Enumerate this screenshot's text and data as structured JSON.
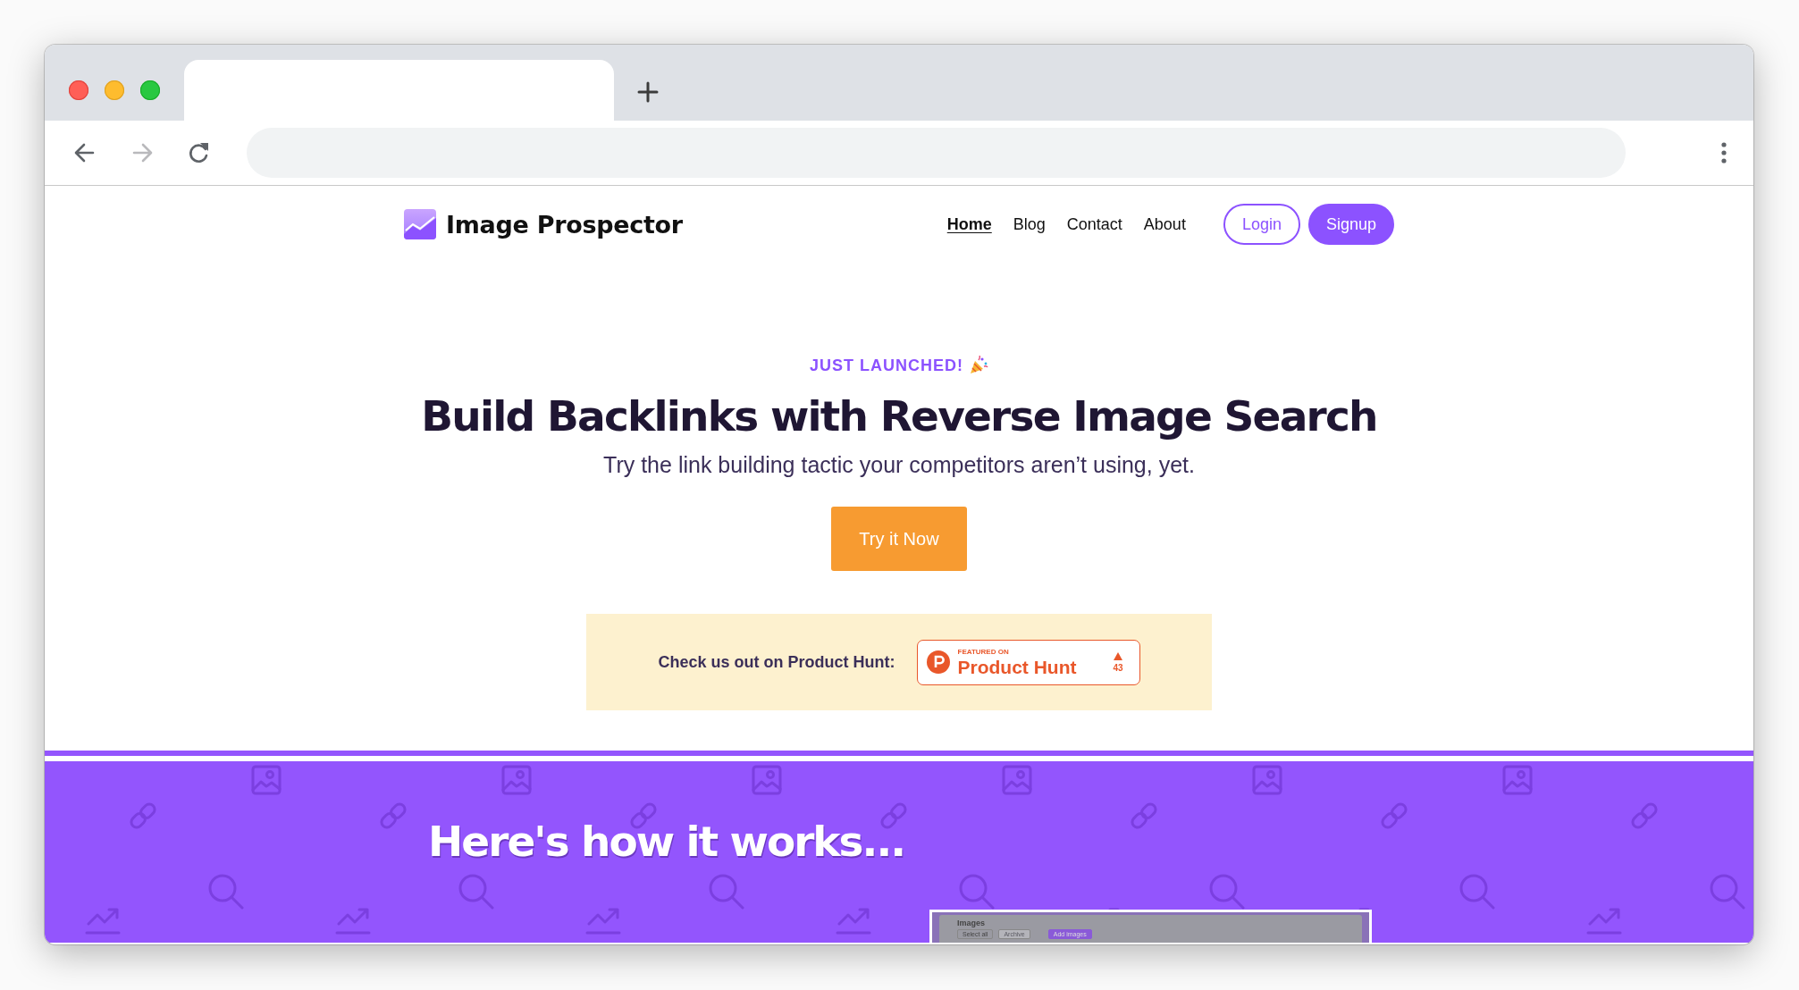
{
  "browser": {
    "back": {
      "disabled": false
    },
    "forward": {
      "disabled": true
    }
  },
  "nav": {
    "logo": "Image Prospector",
    "links": [
      {
        "label": "Home",
        "selected": true
      },
      {
        "label": "Blog",
        "selected": false
      },
      {
        "label": "Contact",
        "selected": false
      },
      {
        "label": "About",
        "selected": false
      }
    ],
    "buttons": [
      {
        "label": "Login",
        "kind": "outline"
      },
      {
        "label": "Signup",
        "kind": "filled"
      }
    ]
  },
  "hero": {
    "eyebrow": "JUST LAUNCHED!",
    "title": "Build Backlinks with Reverse Image Search",
    "subtitle": "Try the link building tactic your competitors aren’t using, yet.",
    "cta": "Try it Now"
  },
  "product_hunt": {
    "label": "Check us out on Product Hunt:",
    "badge": {
      "overline": "FEATURED ON",
      "name": "Product Hunt",
      "votes": "43"
    }
  },
  "how_it_works": {
    "title": "Here's how it works...",
    "preview": {
      "title": "Images",
      "actions": [
        {
          "label": "Select all",
          "kind": "plain"
        },
        {
          "label": "Archive",
          "kind": "disabled"
        },
        {
          "label": "Add images",
          "kind": "primary"
        }
      ]
    }
  }
}
